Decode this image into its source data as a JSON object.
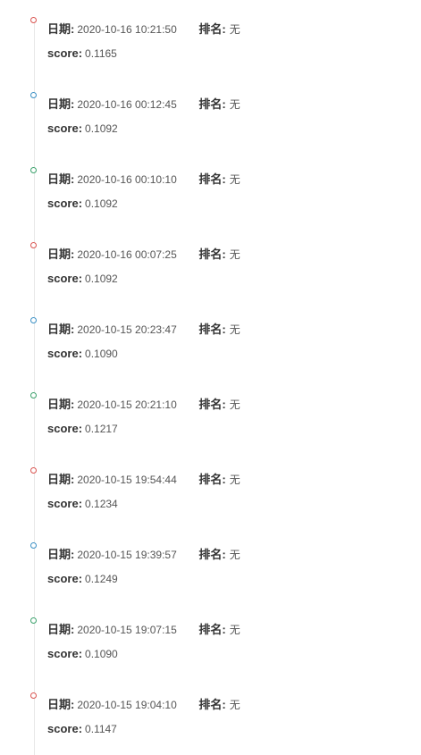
{
  "labels": {
    "date": "日期:",
    "rank": "排名:",
    "score": "score:"
  },
  "entries": [
    {
      "date": "2020-10-16 10:21:50",
      "rank": "无",
      "score": "0.1165",
      "dot_color": "#d9534f"
    },
    {
      "date": "2020-10-16 00:12:45",
      "rank": "无",
      "score": "0.1092",
      "dot_color": "#3a8fc4"
    },
    {
      "date": "2020-10-16 00:10:10",
      "rank": "无",
      "score": "0.1092",
      "dot_color": "#3aa06a"
    },
    {
      "date": "2020-10-16 00:07:25",
      "rank": "无",
      "score": "0.1092",
      "dot_color": "#d9534f"
    },
    {
      "date": "2020-10-15 20:23:47",
      "rank": "无",
      "score": "0.1090",
      "dot_color": "#3a8fc4"
    },
    {
      "date": "2020-10-15 20:21:10",
      "rank": "无",
      "score": "0.1217",
      "dot_color": "#3aa06a"
    },
    {
      "date": "2020-10-15 19:54:44",
      "rank": "无",
      "score": "0.1234",
      "dot_color": "#d9534f"
    },
    {
      "date": "2020-10-15 19:39:57",
      "rank": "无",
      "score": "0.1249",
      "dot_color": "#3a8fc4"
    },
    {
      "date": "2020-10-15 19:07:15",
      "rank": "无",
      "score": "0.1090",
      "dot_color": "#3aa06a"
    },
    {
      "date": "2020-10-15 19:04:10",
      "rank": "无",
      "score": "0.1147",
      "dot_color": "#d9534f"
    }
  ],
  "timeline_line_color": "#e8e8e8"
}
